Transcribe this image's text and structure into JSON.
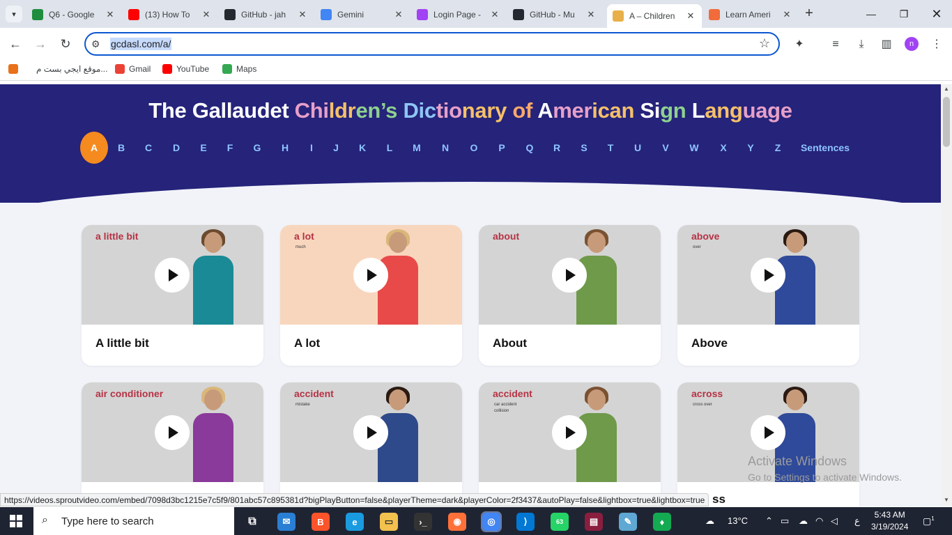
{
  "browser": {
    "tabs": [
      {
        "title": "Q6 - Google",
        "icon": "sheets-icon",
        "color": "#1e8e3e"
      },
      {
        "title": "(13) How To",
        "icon": "youtube-icon",
        "color": "#ff0000"
      },
      {
        "title": "GitHub - jah",
        "icon": "github-icon",
        "color": "#24292f"
      },
      {
        "title": "Gemini",
        "icon": "gemini-icon",
        "color": "#4285f4"
      },
      {
        "title": "Login Page -",
        "icon": "chat-icon",
        "color": "#a142f4"
      },
      {
        "title": "GitHub - Mu",
        "icon": "github-icon",
        "color": "#24292f"
      },
      {
        "title": "A – Children",
        "icon": "gallaudet-icon",
        "color": "#e8b04a"
      },
      {
        "title": "Learn Ameri",
        "icon": "learn-icon",
        "color": "#f26b3a"
      }
    ],
    "active_tab": 6,
    "url": "gcdasl.com/a/",
    "bookmarks": [
      {
        "label": "موقع ايجي بست م...",
        "color": "#e8711a"
      },
      {
        "label": "Gmail",
        "color": "#ea4335"
      },
      {
        "label": "YouTube",
        "color": "#ff0000"
      },
      {
        "label": "Maps",
        "color": "#34a853"
      }
    ],
    "avatar_letter": "n",
    "status_url": "https://videos.sproutvideo.com/embed/7098d3bc1215e7c5f9/801abc57c895381d?bigPlayButton=false&playerTheme=dark&playerColor=2f3437&autoPlay=false&lightbox=true&lightbox=true"
  },
  "site": {
    "title_parts": [
      {
        "text": "The Gallaudet ",
        "cls": "c6"
      },
      {
        "text": "Chi",
        "cls": "c1"
      },
      {
        "text": "ldr",
        "cls": "c2"
      },
      {
        "text": "en’s ",
        "cls": "c3"
      },
      {
        "text": "Dic",
        "cls": "c4"
      },
      {
        "text": "tio",
        "cls": "c1"
      },
      {
        "text": "nary ",
        "cls": "c2"
      },
      {
        "text": "of ",
        "cls": "c5"
      },
      {
        "text": "A",
        "cls": "c6"
      },
      {
        "text": "mer",
        "cls": "c1"
      },
      {
        "text": "ican ",
        "cls": "c2"
      },
      {
        "text": "Si",
        "cls": "c6"
      },
      {
        "text": "gn ",
        "cls": "c3"
      },
      {
        "text": "L",
        "cls": "c6"
      },
      {
        "text": "ang",
        "cls": "c2"
      },
      {
        "text": "uage",
        "cls": "c1"
      }
    ],
    "letters": [
      "A",
      "B",
      "C",
      "D",
      "E",
      "F",
      "G",
      "H",
      "I",
      "J",
      "K",
      "L",
      "M",
      "N",
      "O",
      "P",
      "Q",
      "R",
      "S",
      "T",
      "U",
      "V",
      "W",
      "X",
      "Y",
      "Z",
      "Sentences"
    ],
    "active_letter": "A",
    "cards": [
      {
        "label": "A little bit",
        "word": "a little bit",
        "sub": "",
        "bg": "gray",
        "shirt": "#1a8a96",
        "hair": "#6b4a2e"
      },
      {
        "label": "A lot",
        "word": "a lot",
        "sub": "much",
        "bg": "peach",
        "shirt": "#e84a4a",
        "hair": "#d9b77a"
      },
      {
        "label": "About",
        "word": "about",
        "sub": "",
        "bg": "gray",
        "shirt": "#6e9a4a",
        "hair": "#7a5232"
      },
      {
        "label": "Above",
        "word": "above",
        "sub": "over",
        "bg": "gray",
        "shirt": "#2f4a9a",
        "hair": "#2a1a12"
      },
      {
        "label": "",
        "word": "air conditioner",
        "sub": "",
        "bg": "gray",
        "shirt": "#8a3a9a",
        "hair": "#d9b77a"
      },
      {
        "label": "",
        "word": "accident",
        "sub": "mistake",
        "bg": "gray",
        "shirt": "#2f4a8a",
        "hair": "#2a1a12"
      },
      {
        "label": "",
        "word": "accident",
        "sub": "car accident\ncollision",
        "bg": "gray",
        "shirt": "#6e9a4a",
        "hair": "#7a5232"
      },
      {
        "label": "ss",
        "word": "across",
        "sub": "cross over",
        "bg": "gray",
        "shirt": "#2f4a9a",
        "hair": "#2a1a12"
      }
    ]
  },
  "watermark": {
    "line1": "Activate Windows",
    "line2": "Go to Settings to activate Windows."
  },
  "taskbar": {
    "search_placeholder": "Type here to search",
    "weather": "13°C",
    "lang": "ع",
    "time": "5:43 AM",
    "date": "3/19/2024",
    "notif_count": "1",
    "whatsapp_badge": "63"
  }
}
